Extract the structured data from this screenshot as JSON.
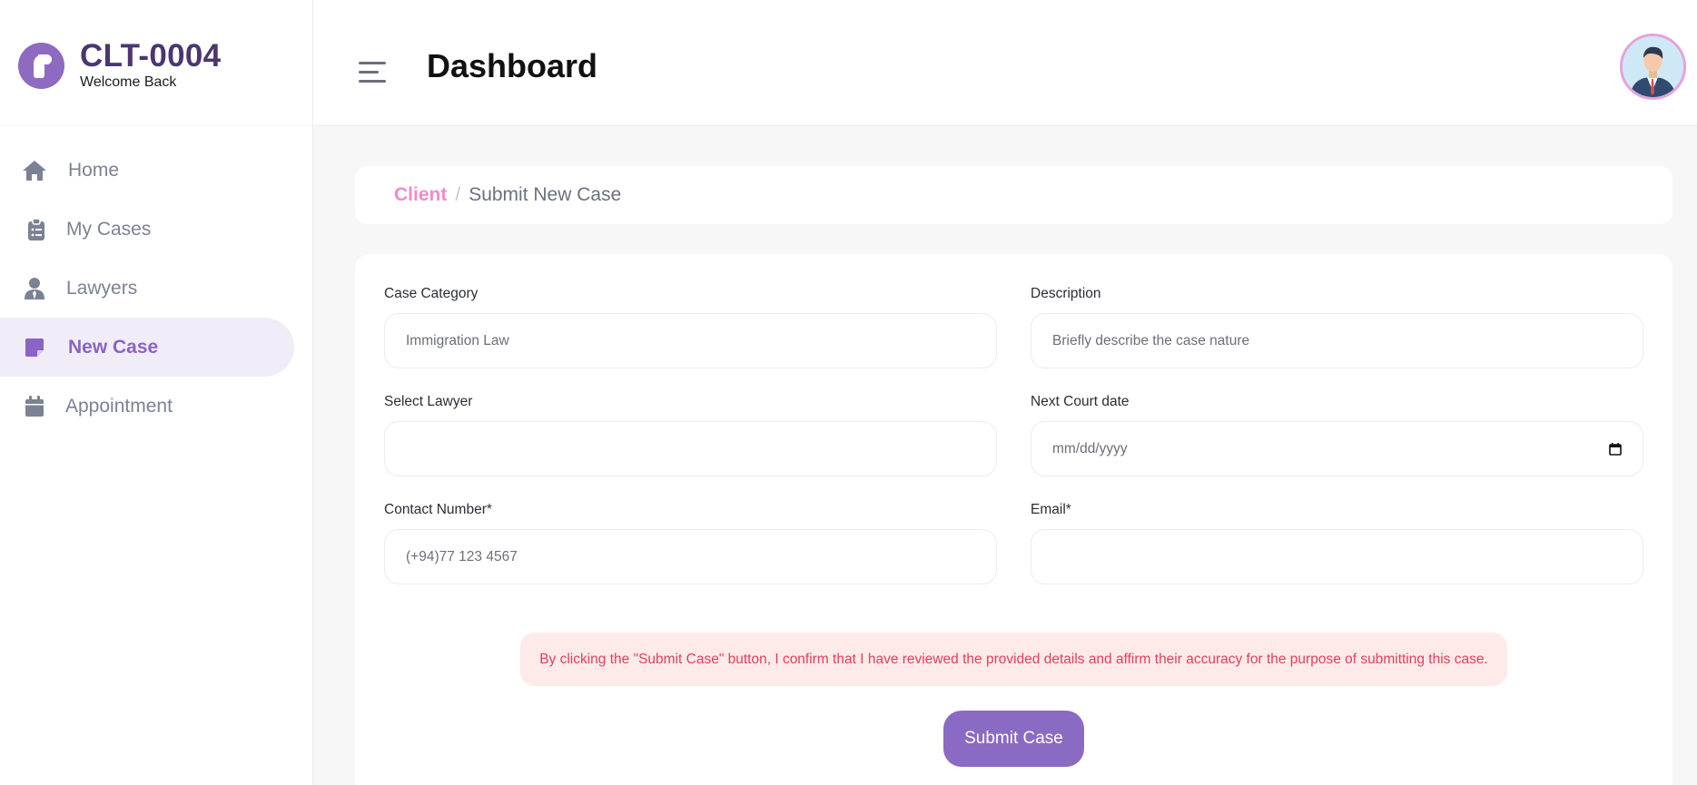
{
  "brand": {
    "client_id": "CLT-0004",
    "welcome": "Welcome Back"
  },
  "sidebar": {
    "items": [
      {
        "label": "Home",
        "icon": "home-icon"
      },
      {
        "label": "My Cases",
        "icon": "clipboard-icon"
      },
      {
        "label": "Lawyers",
        "icon": "user-tie-icon"
      },
      {
        "label": "New Case",
        "icon": "note-icon",
        "active": true
      },
      {
        "label": "Appointment",
        "icon": "calendar-icon"
      }
    ]
  },
  "header": {
    "title": "Dashboard"
  },
  "breadcrumb": {
    "parent": "Client",
    "separator": "/",
    "current": "Submit New Case"
  },
  "form": {
    "case_category": {
      "label": "Case Category",
      "value": "Immigration Law"
    },
    "description": {
      "label": "Description",
      "placeholder": "Briefly describe the case nature"
    },
    "select_lawyer": {
      "label": "Select Lawyer",
      "value": ""
    },
    "next_court_date": {
      "label": "Next Court date",
      "placeholder": "mm/dd/yyyy"
    },
    "contact_number": {
      "label": "Contact Number*",
      "placeholder": "(+94)77 123 4567"
    },
    "email": {
      "label": "Email*",
      "value": ""
    },
    "notice": "By clicking the \"Submit Case\" button, I confirm that I have reviewed the provided details and affirm their accuracy for the purpose of submitting this case.",
    "submit_label": "Submit Case"
  },
  "colors": {
    "accent": "#8b6ac3",
    "brand_dark": "#4b3670",
    "breadcrumb_link": "#f08ccb",
    "notice_text": "#e2405b",
    "notice_bg": "#ffeaea"
  }
}
